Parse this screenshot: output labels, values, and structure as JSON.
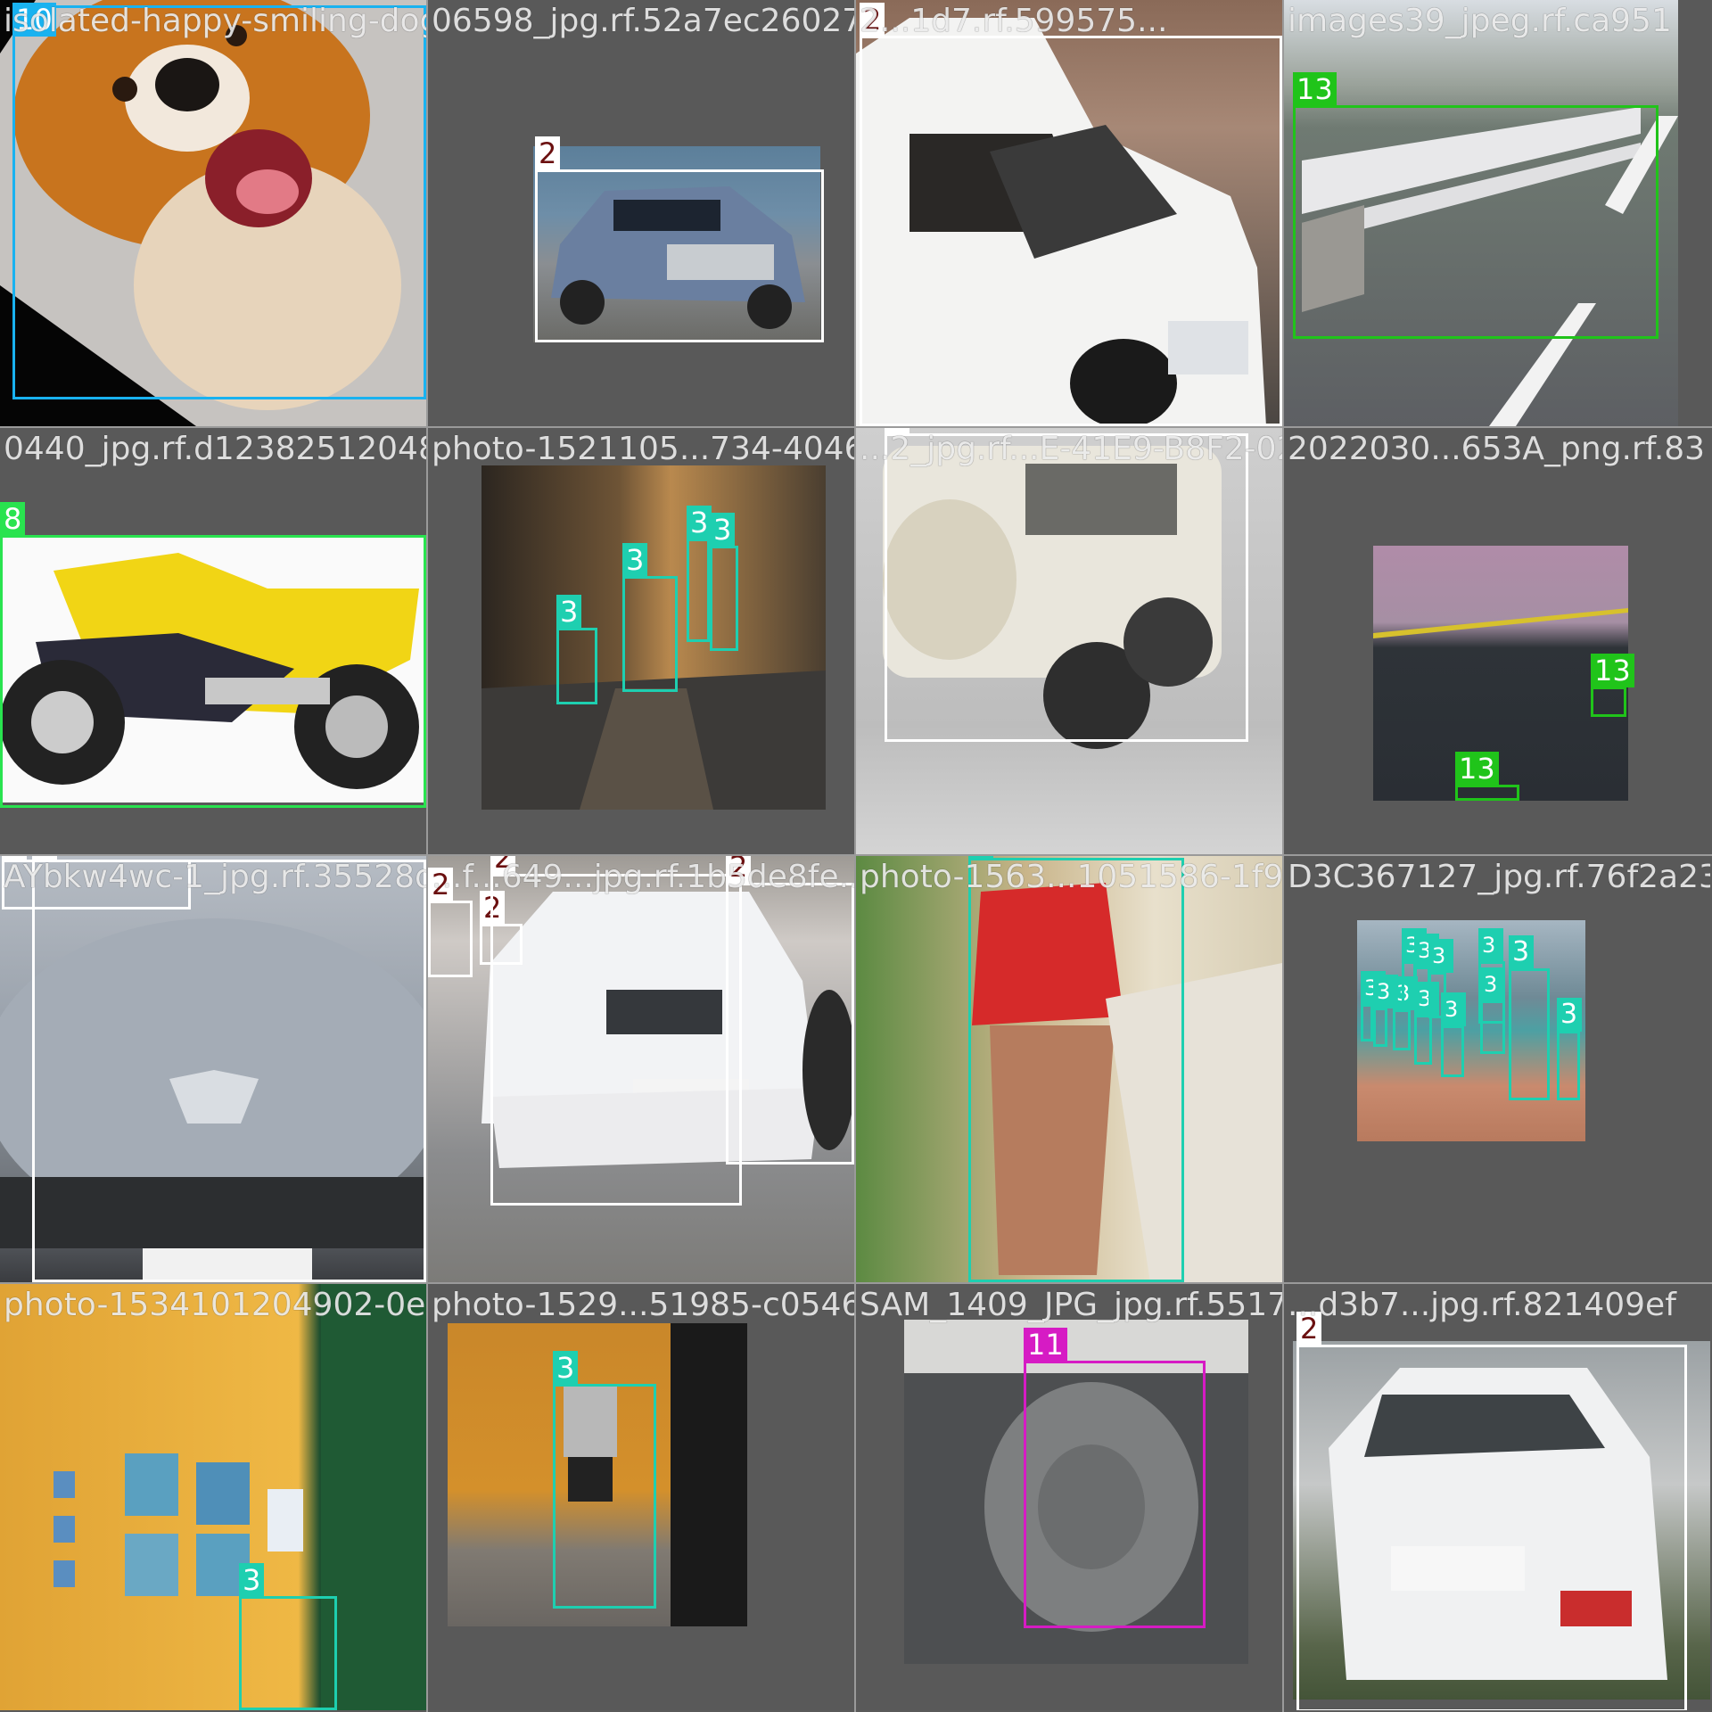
{
  "colors": {
    "2": "#ffffff",
    "3": "#1ecfb0",
    "8": "#29e34f",
    "10": "#19b2f0",
    "11": "#d61bc4",
    "13": "#20c41a"
  },
  "tiles": [
    {
      "filename": "isolated-happy-smiling-dog-white-background-portrait-4_1398_jpg.rf.ca951...",
      "image_label": "happy smiling dog portrait",
      "labels": [
        "10"
      ]
    },
    {
      "filename": "06598_jpg.rf.52a7ec26027512831b45...",
      "image_label": "blue SUV on road",
      "labels": [
        "2"
      ]
    },
    {
      "filename": "2...1d7.rf.599575...",
      "image_label": "white pickup van",
      "labels": [
        "2"
      ]
    },
    {
      "filename": "images39_jpeg.rf.ca951",
      "image_label": "road guardrail",
      "labels": [
        "13"
      ]
    },
    {
      "filename": "0440_jpg.rf.d12382512048d...",
      "image_label": "yellow Suzuki motorcycle",
      "labels": [
        "8"
      ]
    },
    {
      "filename": "photo-1521105...734-40462...",
      "image_label": "people in alley",
      "labels": [
        "3",
        "3",
        "3",
        "3"
      ]
    },
    {
      "filename": "...2_jpg.rf...E-41E9-B8F2-0240DE...",
      "image_label": "blurry white SUV rear",
      "labels": [
        "2"
      ]
    },
    {
      "filename": "2022030...653A_png.rf.83",
      "image_label": "dark road with lane line",
      "labels": [
        "13",
        "13"
      ]
    },
    {
      "filename": "AYbkw4wc-1_jpg.rf.35528df...",
      "image_label": "silver Peugeot front",
      "labels": [
        "2",
        "2"
      ]
    },
    {
      "filename": "...f...649...jpg.rf.1b5de8fe...",
      "image_label": "white Kia sedan",
      "labels": [
        "2",
        "2",
        "2",
        "2",
        "2"
      ]
    },
    {
      "filename": "photo-1563...1051586-1f9b0...",
      "image_label": "woman in red shirt",
      "labels": [
        "3"
      ]
    },
    {
      "filename": "D3C367127_jpg.rf.76f2a23dc",
      "image_label": "sports hall with players",
      "labels": [
        "3",
        "3",
        "3",
        "3",
        "3",
        "3",
        "3",
        "3",
        "3",
        "3",
        "3",
        "3"
      ]
    },
    {
      "filename": "photo-1534101204902-0e91...",
      "image_label": "orange wall with paintings",
      "labels": [
        "3"
      ]
    },
    {
      "filename": "photo-1529...51985-c0546...",
      "image_label": "man leaning on wall",
      "labels": [
        "3"
      ]
    },
    {
      "filename": "SAM_1409_JPG_jpg.rf.5517...",
      "image_label": "manhole cover",
      "labels": [
        "11"
      ]
    },
    {
      "filename": "...d3b7...jpg.rf.821409ef",
      "image_label": "white Pride sedan rear",
      "labels": [
        "2"
      ]
    }
  ]
}
